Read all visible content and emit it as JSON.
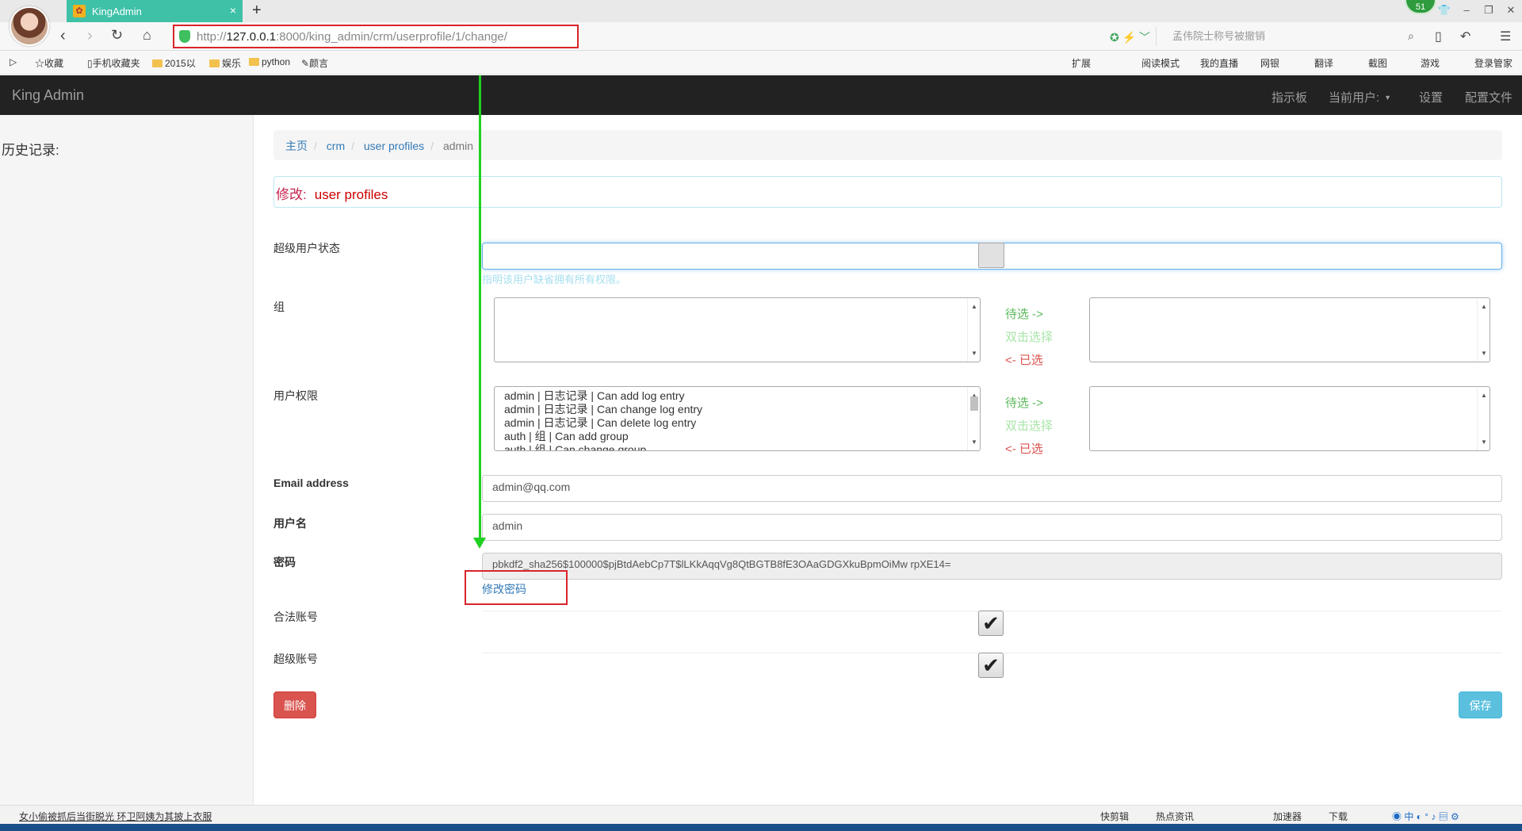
{
  "browser": {
    "tab_title": "KingAdmin",
    "tab_close": "×",
    "new_tab": "+",
    "notify_count": "51",
    "url_scheme": "http://",
    "url_host": "127.0.0.1",
    "url_rest": ":8000/king_admin/crm/userprofile/1/change/",
    "search_placeholder": "孟伟院士称号被撤销",
    "bookmarks": [
      "收藏",
      "手机收藏夹",
      "2015以",
      "娱乐",
      "python",
      "颜言"
    ],
    "toolbar_items": [
      "扩展",
      "阅读模式",
      "我的直播",
      "网银",
      "翻译",
      "截图",
      "游戏",
      "登录管家"
    ]
  },
  "app": {
    "brand": "King Admin",
    "nav": [
      "指示板",
      "当前用户:",
      "设置",
      "配置文件"
    ]
  },
  "sidebar": {
    "title": "历史记录:"
  },
  "breadcrumb": [
    "主页",
    "crm",
    "user profiles",
    "admin"
  ],
  "panel": {
    "prefix": "修改:",
    "model": "user profiles"
  },
  "form": {
    "superuser_label": "超级用户状态",
    "superuser_help": "指明该用户缺省拥有所有权限。",
    "groups_label": "组",
    "perms_label": "用户权限",
    "move_to": "待选 ->",
    "move_hint": "双击选择",
    "move_back": "<- 已选",
    "perm_options": [
      "admin | 日志记录 | Can add log entry",
      "admin | 日志记录 | Can change log entry",
      "admin | 日志记录 | Can delete log entry",
      "auth | 组 | Can add group",
      "auth | 组 | Can change group"
    ],
    "email_label": "Email address",
    "email_value": "admin@qq.com",
    "username_label": "用户名",
    "username_value": "admin",
    "password_label": "密码",
    "password_value": "pbkdf2_sha256$100000$pjBtdAebCp7T$lLKkAqqVg8QtBGTB8fE3OAaGDGXkuBpmOiMw rpXE14=",
    "change_password": "修改密码",
    "active_label": "合法账号",
    "staff_label": "超级账号",
    "checkmark": "✔",
    "delete": "删除",
    "save": "保存"
  },
  "statusbar": {
    "news": "女小偷被抓后当街脱光 环卫阿姨为其披上衣服",
    "items": [
      "快剪辑",
      "热点资讯",
      "加速器",
      "下载"
    ]
  }
}
